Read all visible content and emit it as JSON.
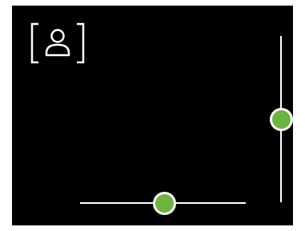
{
  "icons": {
    "camera_toggle": "face-frame-icon"
  },
  "colors": {
    "background": "#000000",
    "track": "#ffffff",
    "thumb": "#6db33f"
  },
  "sliders": {
    "horizontal": {
      "value": 0.5
    },
    "vertical": {
      "value": 0.5
    }
  }
}
